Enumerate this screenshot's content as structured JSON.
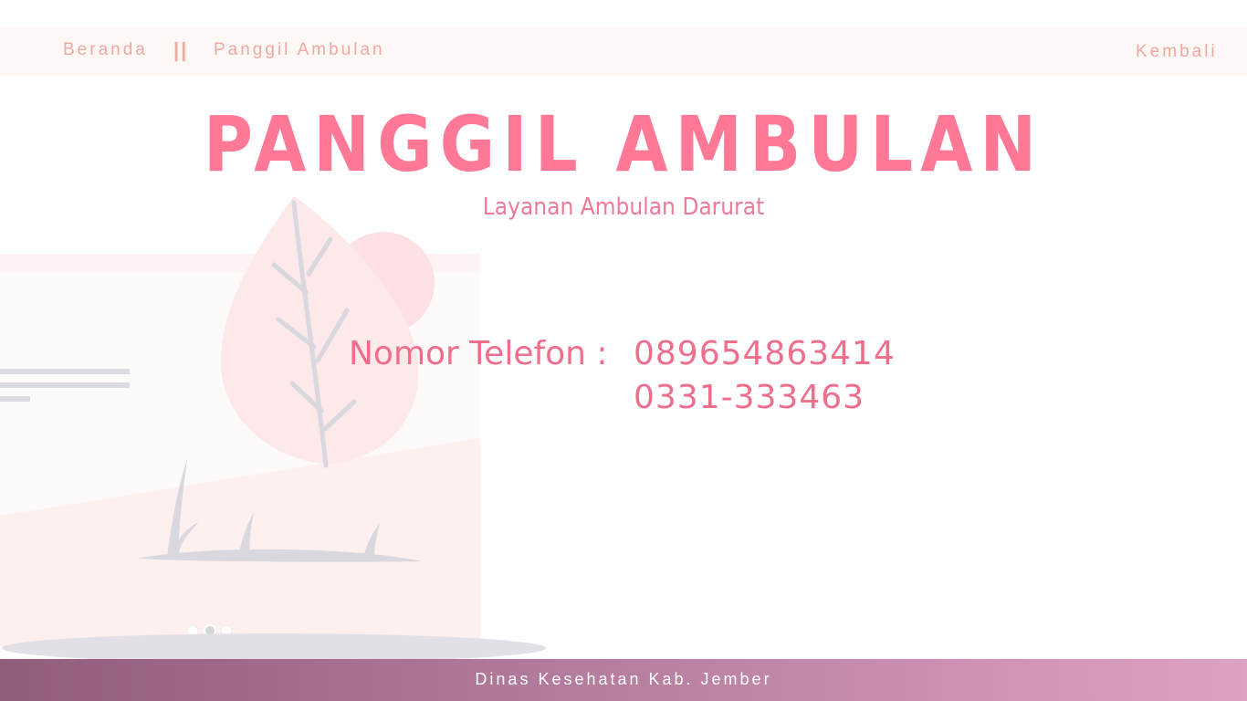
{
  "nav": {
    "home_label": "Beranda",
    "separator": "||",
    "current_label": "Panggil Ambulan",
    "back_label": "Kembali"
  },
  "main": {
    "title": "PANGGIL AMBULAN",
    "subtitle": "Layanan Ambulan Darurat",
    "phone_label": "Nomor Telefon :",
    "phone_numbers": [
      "089654863414",
      "0331-333463"
    ]
  },
  "footer": {
    "text": "Dinas Kesehatan Kab. Jember"
  },
  "colors": {
    "accent": "#ff7896",
    "nav_text": "#f0a9a0",
    "footer_start": "#925c7b",
    "footer_end": "#dfa1c2"
  },
  "illustration": {
    "icon": "tree-illustration-icon"
  }
}
